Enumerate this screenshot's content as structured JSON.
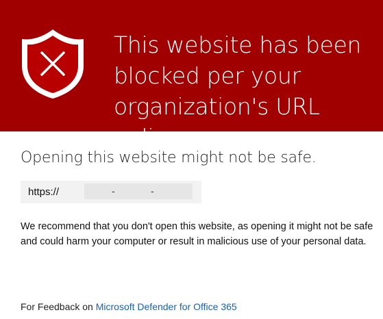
{
  "banner": {
    "title": "This website has been blocked per your organization's URL policy.",
    "icon": "shield-x-icon",
    "background_color": "#a00000"
  },
  "content": {
    "subtitle": "Opening this website might not be safe.",
    "url": {
      "prefix": "https://",
      "separator_1": "-",
      "separator_2": "-"
    },
    "message": "We recommend that you don't open this website, as opening it might not be safe and could harm your computer or result in malicious use of your personal data."
  },
  "footer": {
    "feedback_prefix": "For Feedback on",
    "feedback_link": "Microsoft Defender for Office 365",
    "link_color": "#1a5fb4"
  }
}
